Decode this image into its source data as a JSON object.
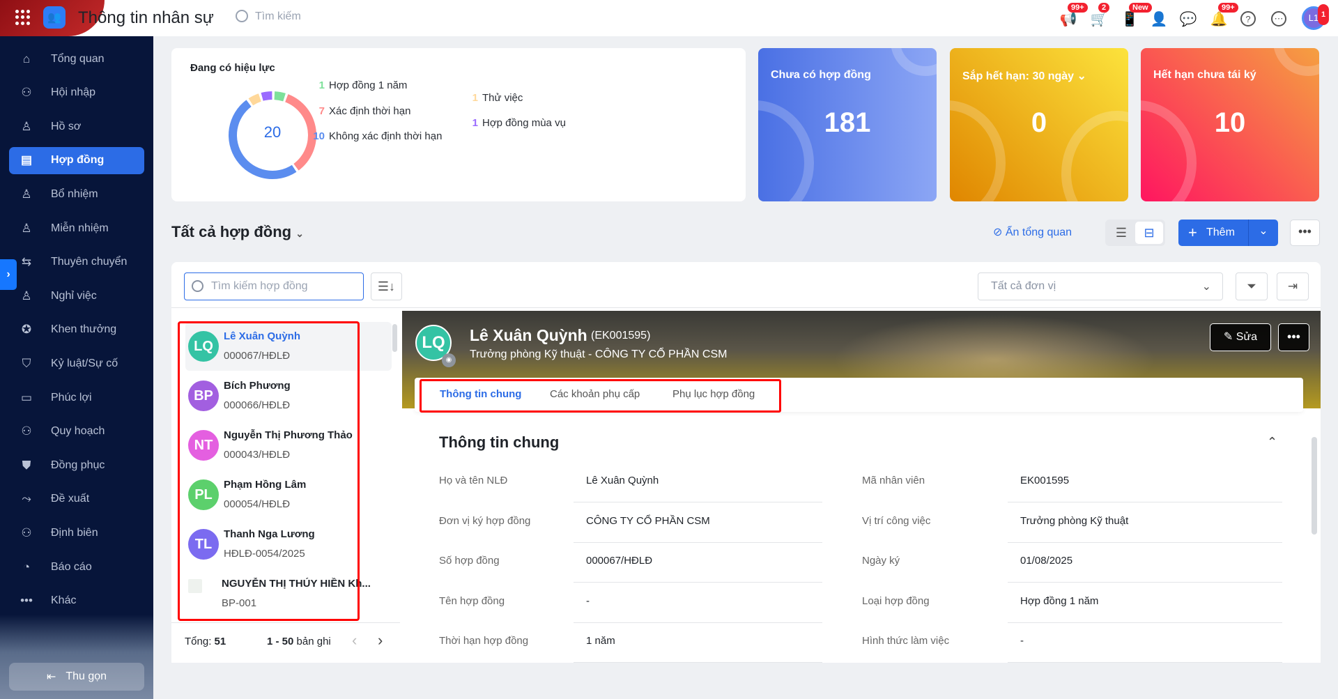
{
  "header": {
    "title": "Thông tin nhân sự",
    "search_placeholder": "Tìm kiếm",
    "icons": [
      {
        "name": "megaphone-icon",
        "badge": "99+"
      },
      {
        "name": "cart-icon",
        "badge": "2"
      },
      {
        "name": "phone-icon",
        "badge": "New"
      },
      {
        "name": "add-user-icon",
        "badge": ""
      },
      {
        "name": "chat-icon",
        "badge": ""
      },
      {
        "name": "bell-icon",
        "badge": "99+"
      },
      {
        "name": "help-icon",
        "badge": ""
      },
      {
        "name": "more-icon",
        "badge": ""
      }
    ],
    "avatar": {
      "initials": "L1",
      "badge": "1"
    }
  },
  "sidebar": {
    "items": [
      {
        "label": "Tổng quan",
        "icon": "⌂"
      },
      {
        "label": "Hội nhập",
        "icon": "⚇"
      },
      {
        "label": "Hồ sơ",
        "icon": "♙"
      },
      {
        "label": "Hợp đồng",
        "icon": "▤",
        "active": true
      },
      {
        "label": "Bổ nhiệm",
        "icon": "♙"
      },
      {
        "label": "Miễn nhiệm",
        "icon": "♙"
      },
      {
        "label": "Thuyên chuyển",
        "icon": "⇆"
      },
      {
        "label": "Nghỉ việc",
        "icon": "♙"
      },
      {
        "label": "Khen thưởng",
        "icon": "✪"
      },
      {
        "label": "Kỷ luật/Sự cố",
        "icon": "⛉"
      },
      {
        "label": "Phúc lợi",
        "icon": "▭"
      },
      {
        "label": "Quy hoạch",
        "icon": "⚇"
      },
      {
        "label": "Đồng phục",
        "icon": "⛊"
      },
      {
        "label": "Đề xuất",
        "icon": "⤳"
      },
      {
        "label": "Định biên",
        "icon": "⚇"
      },
      {
        "label": "Báo cáo",
        "icon": "◔"
      },
      {
        "label": "Khác",
        "icon": "•••"
      }
    ],
    "collapse_label": "Thu gọn"
  },
  "summary": {
    "title": "Đang có hiệu lực",
    "total": "20",
    "legend": [
      {
        "count": "1",
        "label": "Hợp đồng 1 năm",
        "color": "#7ee09a"
      },
      {
        "count": "7",
        "label": "Xác định thời hạn",
        "color": "#ff8a8a"
      },
      {
        "count": "10",
        "label": "Không xác định thời hạn",
        "color": "#5b8def"
      },
      {
        "count": "1",
        "label": "Thử việc",
        "color": "#ffd89a"
      },
      {
        "count": "1",
        "label": "Hợp đồng mùa vụ",
        "color": "#9b6bff"
      }
    ]
  },
  "stats": [
    {
      "label": "Chưa có hợp đồng",
      "value": "181"
    },
    {
      "label": "Sắp hết hạn: 30 ngày ⌄",
      "value": "0"
    },
    {
      "label": "Hết hạn chưa tái ký",
      "value": "10"
    }
  ],
  "toolbar": {
    "heading": "Tất cả hợp đồng",
    "hide_overview": "Ẩn tổng quan",
    "add_label": "Thêm"
  },
  "filters": {
    "search_placeholder": "Tìm kiếm hợp đồng",
    "unit_placeholder": "Tất cả đơn vị"
  },
  "list": {
    "items": [
      {
        "initials": "LQ",
        "name": "Lê Xuân Quỳnh",
        "code": "000067/HĐLĐ",
        "color": "#34c3a4"
      },
      {
        "initials": "BP",
        "name": "Bích Phương",
        "code": "000066/HĐLĐ",
        "color": "#a25fe0"
      },
      {
        "initials": "NT",
        "name": "Nguyễn Thị Phương Thảo",
        "code": "000043/HĐLĐ",
        "color": "#e45fe0"
      },
      {
        "initials": "PL",
        "name": "Phạm Hồng Lâm",
        "code": "000054/HĐLĐ",
        "color": "#5cd06c"
      },
      {
        "initials": "TL",
        "name": "Thanh Nga Lương",
        "code": "HĐLĐ-0054/2025",
        "color": "#7b6bf0"
      },
      {
        "initials": "",
        "name": "NGUYỄN THỊ THÚY HIỀN Kh...",
        "code": "BP-001",
        "color": ""
      }
    ],
    "total_label": "Tổng:",
    "total": "51",
    "range": "1 - 50",
    "range_suffix": "bản ghi"
  },
  "detail": {
    "name": "Lê Xuân Quỳnh",
    "code": "(EK001595)",
    "initials": "LQ",
    "subtitle": "Trưởng phòng Kỹ thuật - CÔNG TY CỔ PHẦN CSM",
    "edit_label": "Sửa",
    "tabs": [
      "Thông tin chung",
      "Các khoản phụ cấp",
      "Phụ lục hợp đồng"
    ],
    "section_title": "Thông tin chung",
    "fields_left": [
      {
        "label": "Họ và tên NLĐ",
        "value": "Lê Xuân Quỳnh"
      },
      {
        "label": "Đơn vị ký hợp đồng",
        "value": "CÔNG TY CỔ PHẦN CSM"
      },
      {
        "label": "Số hợp đồng",
        "value": "000067/HĐLĐ"
      },
      {
        "label": "Tên hợp đồng",
        "value": "-"
      },
      {
        "label": "Thời hạn hợp đồng",
        "value": "1 năm"
      }
    ],
    "fields_right": [
      {
        "label": "Mã nhân viên",
        "value": "EK001595"
      },
      {
        "label": "Vị trí công việc",
        "value": "Trưởng phòng Kỹ thuật"
      },
      {
        "label": "Ngày ký",
        "value": "01/08/2025"
      },
      {
        "label": "Loại hợp đồng",
        "value": "Hợp đồng 1 năm"
      },
      {
        "label": "Hình thức làm việc",
        "value": "-"
      }
    ]
  }
}
